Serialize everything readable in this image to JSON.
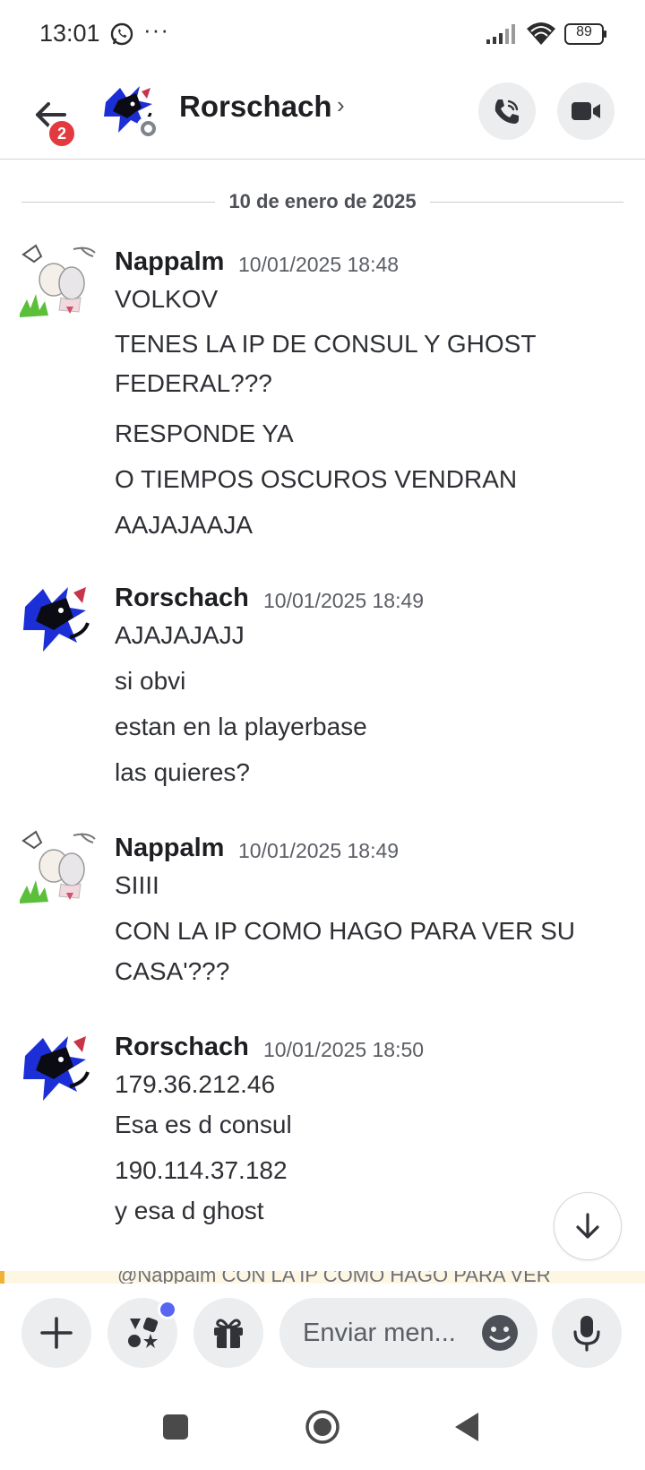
{
  "status_bar": {
    "time": "13:01",
    "more": "···",
    "battery": "89",
    "icons": [
      "whatsapp-icon",
      "signal-icon",
      "wifi-icon",
      "battery-icon"
    ]
  },
  "header": {
    "title": "Rorschach",
    "chevron": "›",
    "back_badge": "2",
    "status": "offline",
    "icons": [
      "back-arrow-icon",
      "voice-call-icon",
      "video-call-icon"
    ]
  },
  "chat": {
    "date_divider": "10 de enero de 2025",
    "messages": [
      {
        "author": "Nappalm",
        "timestamp": "10/01/2025 18:48",
        "lines": [
          "VOLKOV",
          "TENES LA IP DE CONSUL Y GHOST",
          "FEDERAL???",
          "RESPONDE YA",
          "O TIEMPOS OSCUROS VENDRAN",
          "AAJAJAAJA"
        ]
      },
      {
        "author": "Rorschach",
        "timestamp": "10/01/2025 18:49",
        "lines": [
          "AJAJAJAJJ",
          "si obvi",
          "estan en la playerbase",
          "las quieres?"
        ]
      },
      {
        "author": "Nappalm",
        "timestamp": "10/01/2025 18:49",
        "lines": [
          "SIIII",
          "CON LA IP COMO HAGO PARA VER SU",
          "CASA'???"
        ]
      },
      {
        "author": "Rorschach",
        "timestamp": "10/01/2025 18:50",
        "lines": [
          "179.36.212.46",
          "Esa es d consul",
          "190.114.37.182",
          "y esa d ghost"
        ]
      }
    ],
    "reply_preview": "@Nappalm CON LA IP COMO HAGO PARA VER"
  },
  "composer": {
    "placeholder": "Enviar men...",
    "icons": [
      "plus-icon",
      "apps-icon",
      "gift-icon",
      "emoji-icon",
      "microphone-icon"
    ]
  },
  "colors": {
    "accent": "#5865f2",
    "badge": "#e23a3e",
    "button_bg": "#ebedef",
    "mention_bar": "#f0b232"
  }
}
